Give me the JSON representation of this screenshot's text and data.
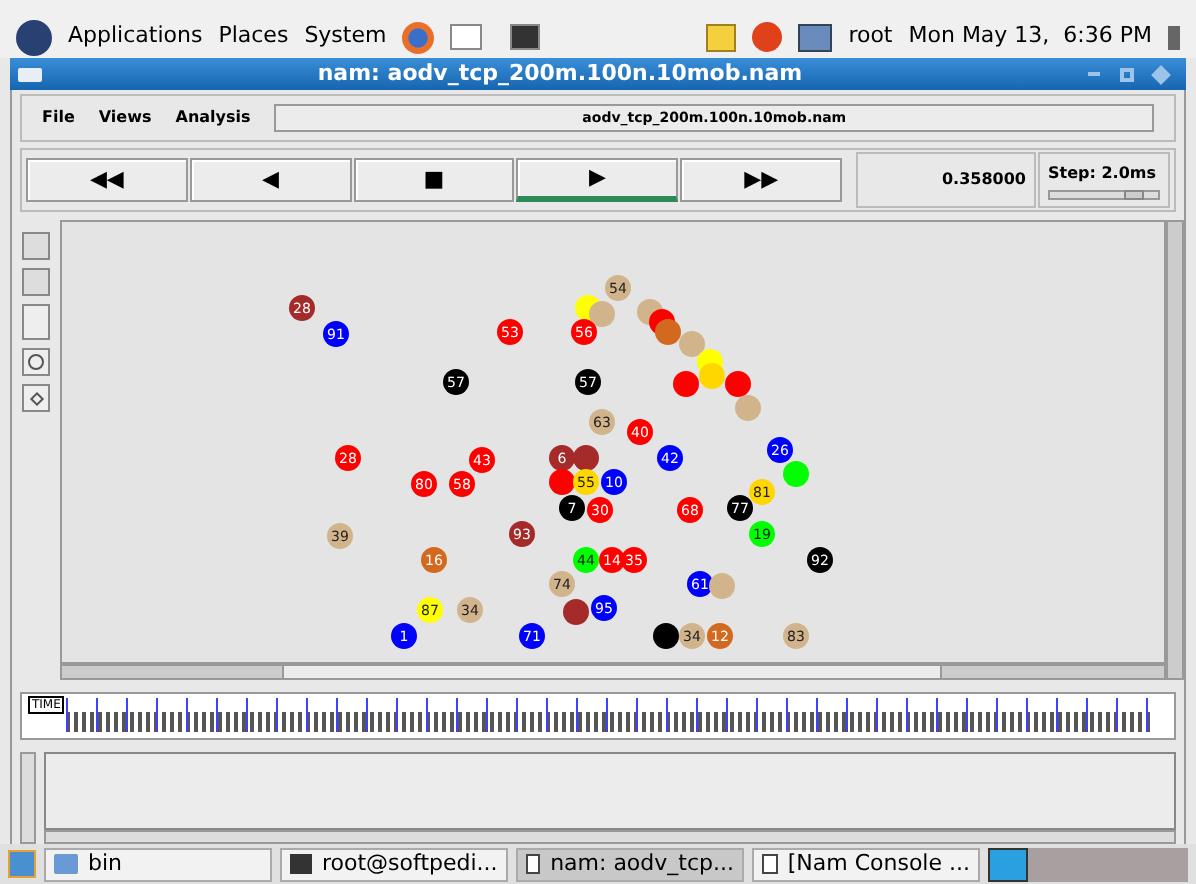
{
  "top_panel": {
    "menus": [
      "Applications",
      "Places",
      "System"
    ],
    "user": "root",
    "clock": "Mon May 13,  6:36 PM"
  },
  "window": {
    "title": "nam: aodv_tcp_200m.100n.10mob.nam"
  },
  "menu": [
    "File",
    "Views",
    "Analysis"
  ],
  "file_label": "aodv_tcp_200m.100n.10mob.nam",
  "controls": [
    {
      "symbol": "◀◀",
      "selected": false
    },
    {
      "symbol": "◀",
      "selected": false
    },
    {
      "symbol": "■",
      "selected": false
    },
    {
      "symbol": "▶",
      "selected": true
    },
    {
      "symbol": "▶▶",
      "selected": false
    }
  ],
  "time": "0.358000",
  "step": {
    "label": "Step: 2.0ms",
    "level": 0.78
  },
  "nodes": [
    {
      "color": "#d2b48c",
      "label": "54"
    },
    {
      "color": "#a52a2a",
      "label": "28"
    },
    {
      "color": "#ffff00"
    },
    {
      "color": "#d2b48c"
    },
    {
      "color": "#d2b48c"
    },
    {
      "color": "#ff0000"
    },
    {
      "color": "#0000ff",
      "label": "91"
    },
    {
      "color": "#ff0000",
      "label": "53"
    },
    {
      "color": "#ff0000",
      "label": "56"
    },
    {
      "color": "#d2691e"
    },
    {
      "color": "#d2b48c"
    },
    {
      "color": "#ffff00"
    },
    {
      "color": "#000000",
      "label": "57"
    },
    {
      "color": "#000000",
      "label": "57"
    },
    {
      "color": "#ff0000"
    },
    {
      "color": "#ffd700"
    },
    {
      "color": "#ff0000"
    },
    {
      "color": "#d2b48c"
    },
    {
      "color": "#d2b48c",
      "label": "63"
    },
    {
      "color": "#ff0000",
      "label": "40"
    },
    {
      "color": "#ff0000",
      "label": "28"
    },
    {
      "color": "#ff0000",
      "label": "43"
    },
    {
      "color": "#a52a2a",
      "label": "6"
    },
    {
      "color": "#a52a2a"
    },
    {
      "color": "#0000ff",
      "label": "42"
    },
    {
      "color": "#0000ff",
      "label": "26"
    },
    {
      "color": "#00ff00"
    },
    {
      "color": "#ff0000",
      "label": "80"
    },
    {
      "color": "#ff0000",
      "label": "58"
    },
    {
      "color": "#ff0000"
    },
    {
      "color": "#ffd700",
      "label": "55"
    },
    {
      "color": "#0000ff",
      "label": "10"
    },
    {
      "color": "#ffd700",
      "label": "81"
    },
    {
      "color": "#000000",
      "label": "7"
    },
    {
      "color": "#ff0000",
      "label": "30"
    },
    {
      "color": "#ff0000",
      "label": "68"
    },
    {
      "color": "#000000",
      "label": "77"
    },
    {
      "color": "#d2b48c",
      "label": "39"
    },
    {
      "color": "#a52a2a",
      "label": "93"
    },
    {
      "color": "#00ff00",
      "label": "19"
    },
    {
      "color": "#d2691e",
      "label": "16"
    },
    {
      "color": "#00ff00",
      "label": "44"
    },
    {
      "color": "#ff0000",
      "label": "14"
    },
    {
      "color": "#ff0000",
      "label": "35"
    },
    {
      "color": "#000000",
      "label": "92"
    },
    {
      "color": "#d2b48c",
      "label": "74"
    },
    {
      "color": "#0000ff",
      "label": "61"
    },
    {
      "color": "#d2b48c"
    },
    {
      "color": "#ffff00",
      "label": "87"
    },
    {
      "color": "#d2b48c",
      "label": "34"
    },
    {
      "color": "#a52a2a"
    },
    {
      "color": "#0000ff",
      "label": "95"
    },
    {
      "color": "#0000ff",
      "label": "1"
    },
    {
      "color": "#0000ff",
      "label": "71"
    },
    {
      "color": "#000000"
    },
    {
      "color": "#d2b48c",
      "label": "34"
    },
    {
      "color": "#d2691e",
      "label": "12"
    },
    {
      "color": "#d2b48c",
      "label": "83"
    }
  ],
  "timeline": {
    "label": "TIME"
  },
  "taskbar": [
    {
      "label": "bin",
      "kind": "folder",
      "selected": false
    },
    {
      "label": "root@softpedi...",
      "kind": "terminal",
      "selected": false
    },
    {
      "label": "nam: aodv_tcp...",
      "kind": "window",
      "selected": true
    },
    {
      "label": "[Nam Console ...",
      "kind": "window",
      "selected": false
    }
  ]
}
